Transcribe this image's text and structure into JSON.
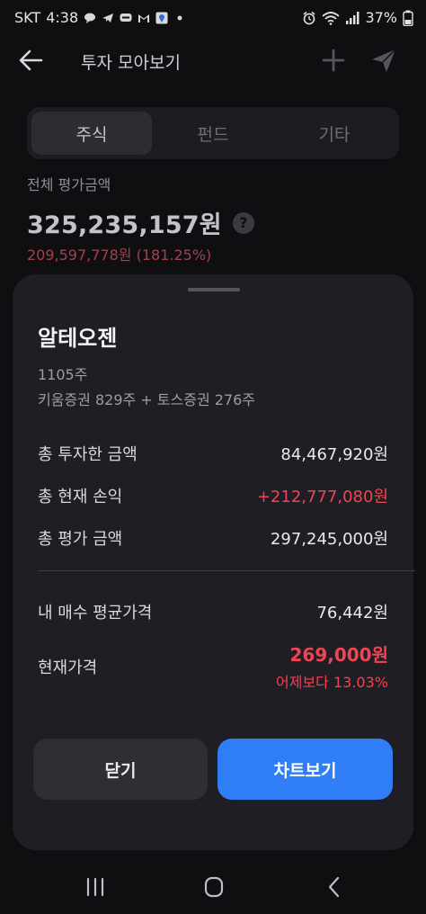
{
  "status": {
    "carrier": "SKT",
    "time": "4:38",
    "battery": "37%",
    "left_icons": [
      "message-bubble-icon",
      "telegram-icon",
      "talk-icon",
      "gmail-icon",
      "location-app-icon",
      "dot-icon"
    ],
    "right_icons": [
      "alarm-icon",
      "wifi-icon",
      "signal-icon",
      "battery-icon"
    ]
  },
  "app_bar": {
    "title": "투자 모아보기"
  },
  "tabs": [
    {
      "label": "주식",
      "active": true
    },
    {
      "label": "펀드",
      "active": false
    },
    {
      "label": "기타",
      "active": false
    }
  ],
  "summary": {
    "label": "전체 평가금액",
    "value": "325,235,157원",
    "help": "?",
    "change": "209,597,778원 (181.25%)"
  },
  "sheet": {
    "stock_name": "알테오젠",
    "quantity": "1105주",
    "breakdown": "키움증권 829주 + 토스증권 276주",
    "rows": [
      {
        "label": "총 투자한 금액",
        "value": "84,467,920원"
      },
      {
        "label": "총 현재 손익",
        "value": "+212,777,080원"
      },
      {
        "label": "총 평가 금액",
        "value": "297,245,000원"
      }
    ],
    "avg_price": {
      "label": "내 매수 평균가격",
      "value": "76,442원"
    },
    "current_price": {
      "label": "현재가격",
      "value": "269,000원",
      "change": "어제보다 13.03%"
    },
    "buttons": {
      "close": "닫기",
      "chart": "차트보기"
    }
  },
  "colors": {
    "accent_blue": "#2f7ef6",
    "gain_red": "#f04452",
    "background": "#0f0f12",
    "sheet": "#1e1e24"
  }
}
